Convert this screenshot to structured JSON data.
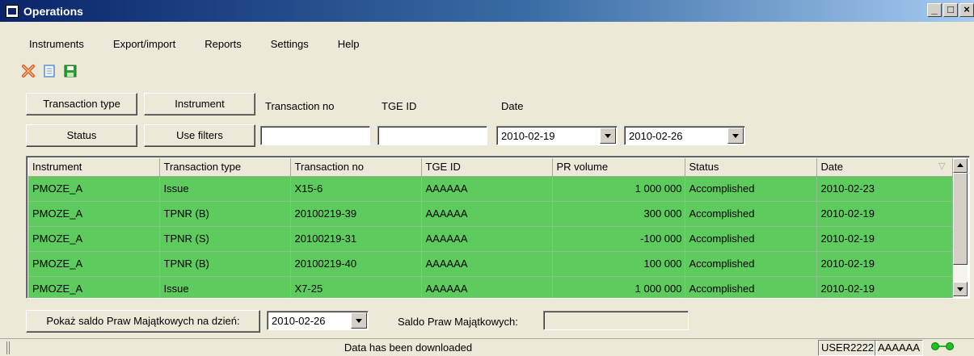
{
  "window": {
    "title": "Operations",
    "min": "_",
    "max": "□",
    "close": "×"
  },
  "menu": [
    "Instruments",
    "Export/import",
    "Reports",
    "Settings",
    "Help"
  ],
  "toolbar": {
    "icons": [
      "delete-icon",
      "document-icon",
      "save-icon"
    ],
    "colors": {
      "delete": "#d9531e",
      "document": "#5b8fd6",
      "save": "#2a9e2a"
    }
  },
  "filters": {
    "transaction_type_btn": "Transaction type",
    "instrument_btn": "Instrument",
    "status_btn": "Status",
    "use_filters_btn": "Use filters",
    "transaction_no_label": "Transaction no",
    "tge_id_label": "TGE ID",
    "date_label": "Date",
    "transaction_no_value": "",
    "tge_id_value": "",
    "date_from": "2010-02-19",
    "date_to": "2010-02-26"
  },
  "grid": {
    "row_color": "#5ecb5e",
    "columns": [
      "Instrument",
      "Transaction type",
      "Transaction no",
      "TGE ID",
      "PR volume",
      "Status",
      "Date"
    ],
    "rows": [
      [
        "PMOZE_A",
        "Issue",
        "X15-6",
        "AAAAAA",
        "1 000 000",
        "Accomplished",
        "2010-02-23"
      ],
      [
        "PMOZE_A",
        "TPNR (B)",
        "20100219-39",
        "AAAAAA",
        "300 000",
        "Accomplished",
        "2010-02-19"
      ],
      [
        "PMOZE_A",
        "TPNR (S)",
        "20100219-31",
        "AAAAAA",
        "-100 000",
        "Accomplished",
        "2010-02-19"
      ],
      [
        "PMOZE_A",
        "TPNR (B)",
        "20100219-40",
        "AAAAAA",
        "100 000",
        "Accomplished",
        "2010-02-19"
      ],
      [
        "PMOZE_A",
        "Issue",
        "X7-25",
        "AAAAAA",
        "1 000 000",
        "Accomplished",
        "2010-02-19"
      ]
    ]
  },
  "balance": {
    "button": "Pokaż saldo Praw Majątkowych na dzień:",
    "date": "2010-02-26",
    "label": "Saldo Praw Majątkowych:",
    "value": ""
  },
  "status": {
    "message": "Data has been downloaded",
    "user": "USER2222",
    "tge": "AAAAAA"
  }
}
